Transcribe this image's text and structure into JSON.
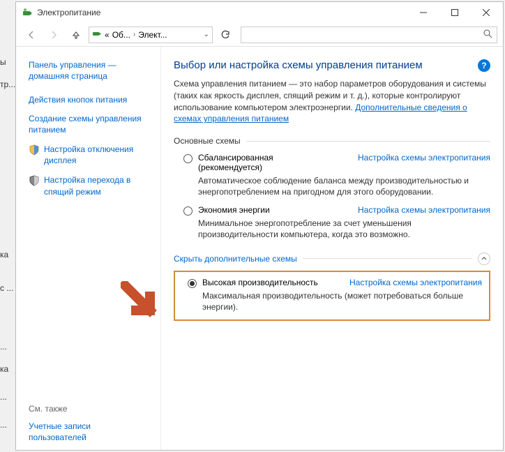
{
  "window": {
    "title": "Электропитание"
  },
  "nav": {
    "crumb1": "Об...",
    "crumb2": "Элект..."
  },
  "sidebar": {
    "home_line1": "Панель управления —",
    "home_line2": "домашняя страница",
    "items": [
      {
        "label": "Действия кнопок питания"
      },
      {
        "label": "Создание схемы управления питанием"
      },
      {
        "label": "Настройка отключения дисплея"
      },
      {
        "label": "Настройка перехода в спящий режим"
      }
    ],
    "see_also": "См. также",
    "accounts": "Учетные записи пользователей"
  },
  "main": {
    "title": "Выбор или настройка схемы управления питанием",
    "desc_pre": "Схема управления питанием — это набор параметров оборудования и системы (таких как яркость дисплея, спящий режим и т. д.), которые контролируют использование компьютером электроэнергии. ",
    "desc_link": "Дополнительные сведения о схемах управления питанием",
    "basic_legend": "Основные схемы",
    "plans": [
      {
        "name": "Сбалансированная",
        "rec": "(рекомендуется)",
        "link": "Настройка схемы электропитания",
        "desc": "Автоматическое соблюдение баланса между производительностью и энергопотреблением на пригодном для этого оборудовании.",
        "checked": false
      },
      {
        "name": "Экономия энергии",
        "rec": "",
        "link": "Настройка схемы электропитания",
        "desc": "Минимальное энергопотребление за счет уменьшения производительности компьютера, когда это возможно.",
        "checked": false
      }
    ],
    "hide_extra": "Скрыть дополнительные схемы",
    "extra_plan": {
      "name": "Высокая производительность",
      "link": "Настройка схемы электропитания",
      "desc": "Максимальная производительность (может потребоваться больше энергии).",
      "checked": true
    }
  },
  "bg": {
    "f1": "ы",
    "f2": "тр...",
    "f3": "ка",
    "f4": "с ...",
    "f5": "...",
    "f6": "ка",
    "f7": "...",
    "f8": "..."
  }
}
